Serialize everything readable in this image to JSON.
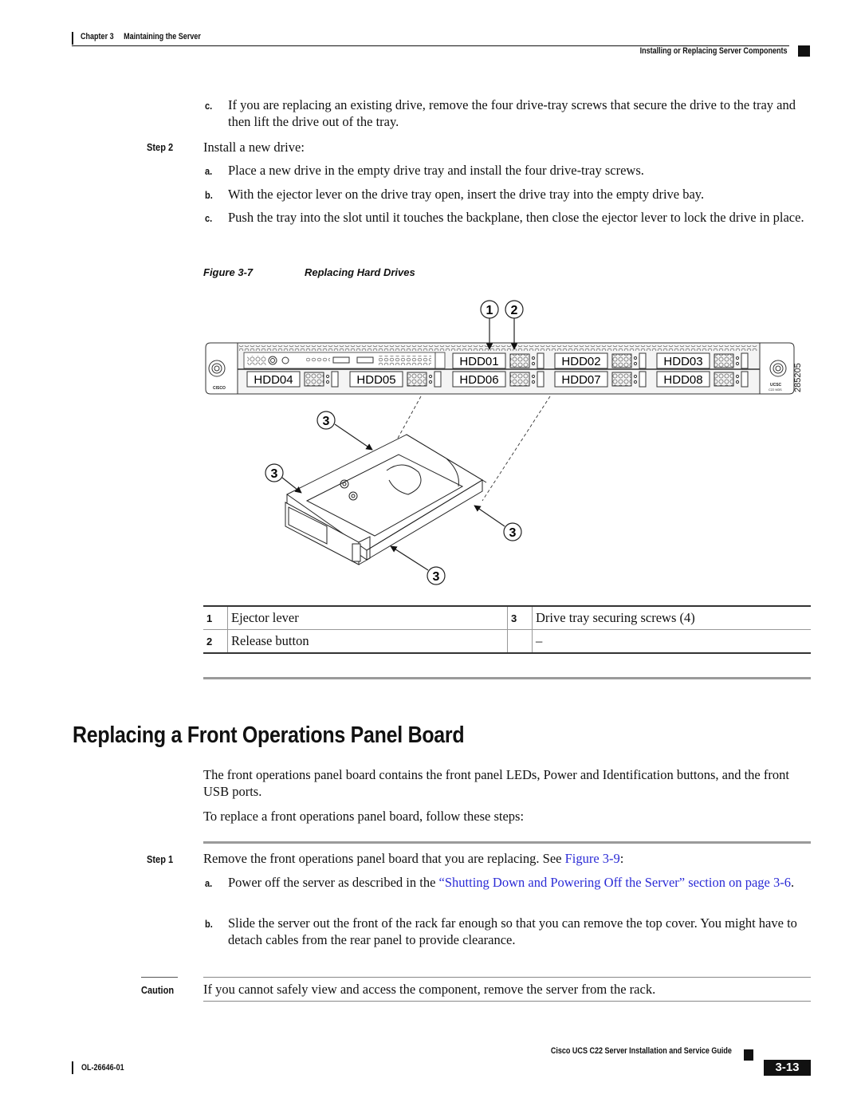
{
  "header": {
    "chapter": "Chapter 3",
    "chapter_title": "Maintaining the Server",
    "section": "Installing or Replacing Server Components"
  },
  "top_steps": {
    "c1": {
      "label": "c.",
      "text": "If you are replacing an existing drive, remove the four drive-tray screws that secure the drive to the tray and then lift the drive out of the tray."
    },
    "step2": {
      "label": "Step 2",
      "text": "Install a new drive:"
    },
    "a": {
      "label": "a.",
      "text": "Place a new drive in the empty drive tray and install the four drive-tray screws."
    },
    "b": {
      "label": "b.",
      "text": "With the ejector lever on the drive tray open, insert the drive tray into the empty drive bay."
    },
    "c2": {
      "label": "c.",
      "text": "Push the tray into the slot until it touches the backplane, then close the ejector lever to lock the drive in place."
    }
  },
  "figure": {
    "number": "Figure 3-7",
    "title": "Replacing Hard Drives",
    "callouts": [
      "1",
      "2",
      "3",
      "3",
      "3",
      "3"
    ],
    "bays": [
      "HDD01",
      "HDD02",
      "HDD03",
      "HDD04",
      "HDD05",
      "HDD06",
      "HDD07",
      "HDD08"
    ],
    "brand_left": "CISCO",
    "brand_right": "UCSC",
    "model_right": "C22 M3S",
    "figure_id": "285205"
  },
  "legend": {
    "rows": [
      {
        "n1": "1",
        "d1": "Ejector lever",
        "n2": "3",
        "d2": "Drive tray securing screws (4)"
      },
      {
        "n1": "2",
        "d1": "Release button",
        "n2": "",
        "d2": "–"
      }
    ]
  },
  "section": {
    "title": "Replacing a Front Operations Panel Board",
    "intro": "The front operations panel board contains the front panel LEDs, Power and Identification buttons, and the front USB ports.",
    "lead": "To replace a front operations panel board, follow these steps:",
    "step1": {
      "label": "Step 1",
      "text": "Remove the front operations panel board that you are replacing. See ",
      "link": "Figure 3-9",
      "tail": ":"
    },
    "a": {
      "label": "a.",
      "text": "Power off the server as described in the ",
      "link": "“Shutting Down and Powering Off the Server” section on page 3-6",
      "tail": "."
    },
    "b": {
      "label": "b.",
      "text": "Slide the server out the front of the rack far enough so that you can remove the top cover. You might have to detach cables from the rear panel to provide clearance."
    },
    "caution": {
      "label": "Caution",
      "text": "If you cannot safely view and access the component, remove the server from the rack."
    }
  },
  "footer": {
    "guide_title": "Cisco UCS C22 Server Installation and Service Guide",
    "doc_id": "OL-26646-01",
    "page": "3-13"
  },
  "colors": {
    "link": "#2b2bd6",
    "rule": "#9a9a9a"
  }
}
